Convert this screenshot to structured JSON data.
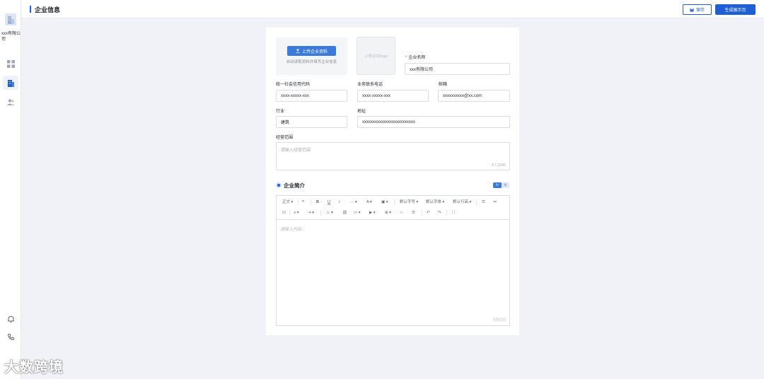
{
  "sidebar": {
    "company": "xxx有限公司",
    "nav": [
      "grid-icon",
      "building-icon",
      "users-icon"
    ],
    "bottom": [
      "bell-icon",
      "phone-icon"
    ]
  },
  "header": {
    "title": "企业信息",
    "save_label": "保存",
    "generate_label": "生成展示页"
  },
  "upload": {
    "button_label": "上传企业资料",
    "hint": "自动读取资料并填写企业信息",
    "logo_placeholder": "上传企业logo"
  },
  "form": {
    "company_name": {
      "label": "企业名称",
      "required_mark": "*",
      "value": "xxx有限公司"
    },
    "credit_code": {
      "label": "统一社会信用代码",
      "value": "xxxx-xxxxx-xxx"
    },
    "phone": {
      "label": "业务联系电话",
      "value": "xxxx-xxxxx-xxx"
    },
    "email": {
      "label": "邮箱",
      "value": "xxxxxxxxxx@xx.com"
    },
    "industry": {
      "label": "行业",
      "value": "建筑"
    },
    "address": {
      "label": "地址",
      "value": "xxxxxxxxxxxxxxxxxxxxxxxxx"
    },
    "scope": {
      "label": "经营范围",
      "placeholder": "请输入经营范围",
      "count": "0 / 2000"
    }
  },
  "intro": {
    "title": "企业简介",
    "toolbar": {
      "paragraph": "正文",
      "font_size": "默认字号",
      "font_family": "默认字体",
      "line_height": "默认行高"
    },
    "placeholder": "请输入内容...",
    "count": "0/5000"
  },
  "watermark": "大数跨境",
  "colors": {
    "primary": "#1f5fd6",
    "background": "#f0f2f7"
  }
}
